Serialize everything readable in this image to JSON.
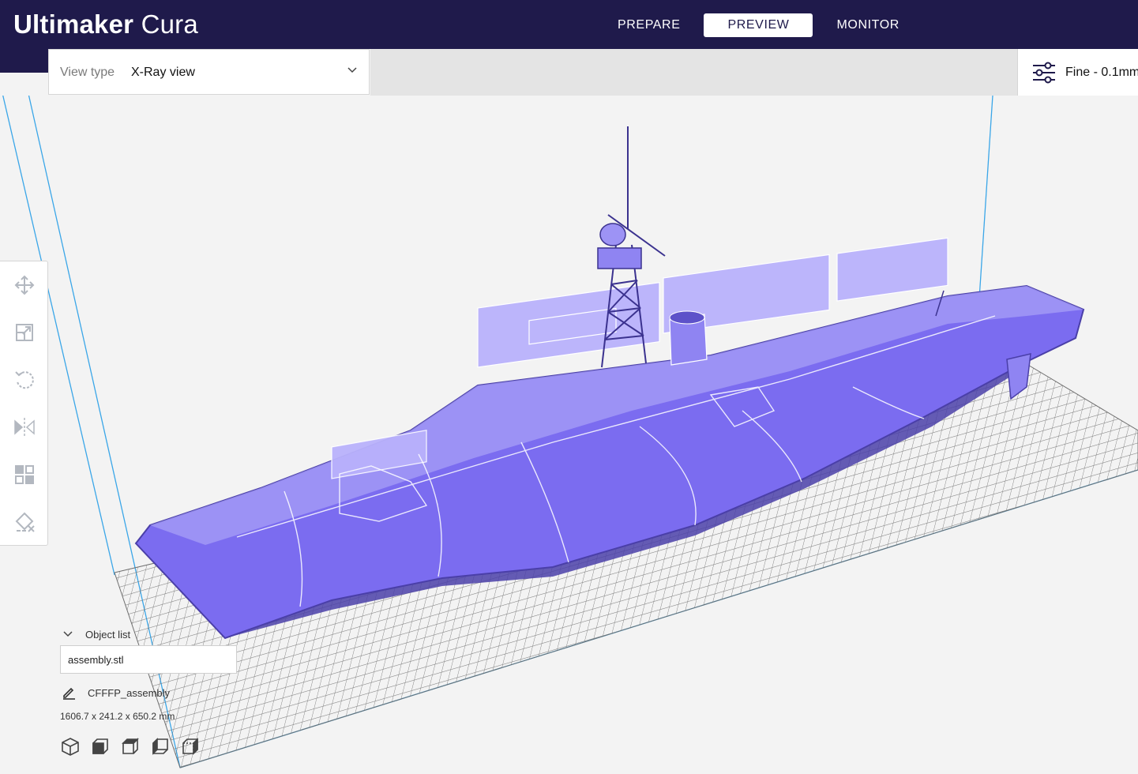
{
  "app": {
    "brand": "Ultimaker",
    "product": "Cura"
  },
  "stages": [
    {
      "label": "PREPARE",
      "active": false
    },
    {
      "label": "PREVIEW",
      "active": true
    },
    {
      "label": "MONITOR",
      "active": false
    }
  ],
  "view_type": {
    "label": "View type",
    "value": "X-Ray view",
    "icon": "chevron-down-icon"
  },
  "print_setup": {
    "icon": "settings-sliders-icon",
    "label": "Fine - 0.1mm"
  },
  "tools": [
    {
      "name": "move-tool",
      "icon": "move-icon"
    },
    {
      "name": "scale-tool",
      "icon": "scale-icon"
    },
    {
      "name": "rotate-tool",
      "icon": "rotate-icon"
    },
    {
      "name": "mirror-tool",
      "icon": "mirror-icon"
    },
    {
      "name": "per-model-settings-tool",
      "icon": "per-model-settings-icon"
    },
    {
      "name": "support-blocker-tool",
      "icon": "support-blocker-icon"
    }
  ],
  "object_list": {
    "title": "Object list",
    "items": [
      "assembly.stl"
    ]
  },
  "job": {
    "name": "CFFFP_assembly",
    "dimensions": "1606.7 x 241.2 x 650.2 mm"
  },
  "camera_views": [
    "3d-view-icon",
    "front-view-icon",
    "top-view-icon",
    "left-view-icon",
    "right-view-icon"
  ],
  "colors": {
    "header": "#1f1a4b",
    "model": "#7b6cf0",
    "model_dark": "#4a3fa8",
    "build_plate_line": "#6f6f6f",
    "volume_outline": "#3aa6e8",
    "background": "#f3f3f3"
  }
}
